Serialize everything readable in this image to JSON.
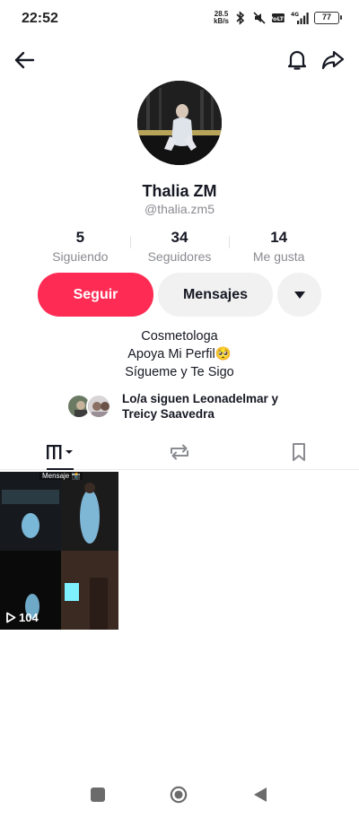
{
  "status_bar": {
    "time": "22:52",
    "net_speed_value": "28.5",
    "net_speed_unit": "kB/s",
    "network_label": "4G",
    "battery": "77",
    "icons": [
      "bluetooth-icon",
      "mute-icon",
      "volte-icon",
      "signal-icon",
      "battery-icon"
    ]
  },
  "nav": {
    "back_icon": "arrow-left-icon",
    "bell_icon": "bell-icon",
    "share_icon": "share-icon"
  },
  "profile": {
    "name": "Thalia ZM",
    "handle": "@thalia.zm5"
  },
  "stats": [
    {
      "value": "5",
      "label": "Siguiendo"
    },
    {
      "value": "34",
      "label": "Seguidores"
    },
    {
      "value": "14",
      "label": "Me gusta"
    }
  ],
  "actions": {
    "follow": "Seguir",
    "message": "Mensajes",
    "more_icon": "caret-down-icon"
  },
  "bio": {
    "line1": "Cosmetologa",
    "line2": "Apoya Mi Perfil",
    "line2_emoji": "🥺",
    "line3": "Sígueme y Te Sigo"
  },
  "followed_by": {
    "line1": "Lo/a siguen Leonadelmar y",
    "line2": "Treicy Saavedra"
  },
  "tabs": [
    {
      "name": "videos-tab",
      "icon": "grid-icon",
      "active": true
    },
    {
      "name": "reposts-tab",
      "icon": "repost-icon",
      "active": false
    },
    {
      "name": "favorites-tab",
      "icon": "bookmark-icon",
      "active": false
    }
  ],
  "videos": [
    {
      "views": "104",
      "caption": "Mensaje 📸"
    }
  ],
  "colors": {
    "accent": "#fe2c55",
    "secondary_button": "#f1f1f2",
    "muted_text": "#8a8b91"
  }
}
